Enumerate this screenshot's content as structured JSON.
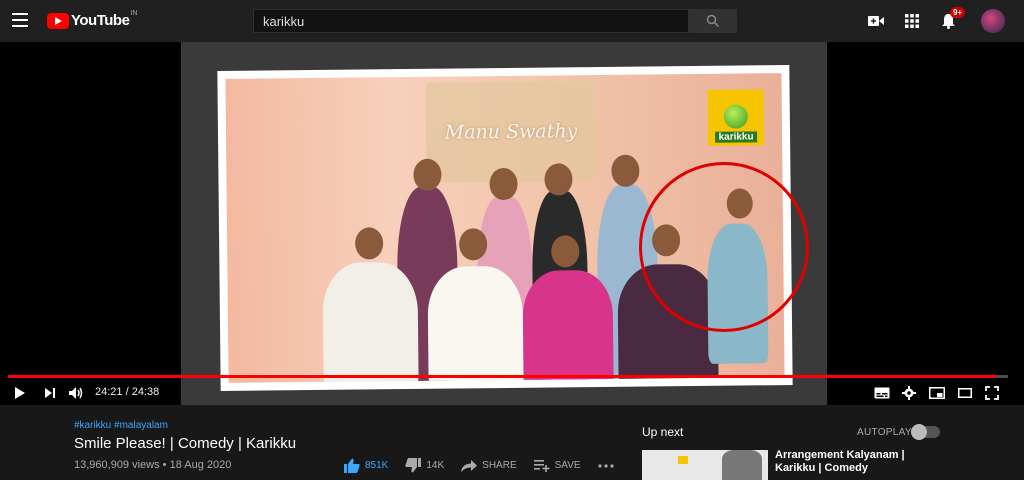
{
  "header": {
    "logo_text": "YouTube",
    "country_code": "IN",
    "search_value": "karikku",
    "notification_count": "9+"
  },
  "player": {
    "video_logo_text": "karikku",
    "stage_text": "Manu Swathy",
    "current_time": "24:21",
    "duration": "24:38",
    "time_display": "24:21 / 24:38",
    "progress_fraction": 0.988
  },
  "video": {
    "tags": "#karikku #malayalam",
    "title": "Smile Please! | Comedy | Karikku",
    "views_date": "13,960,909 views • 18 Aug 2020",
    "likes": "851K",
    "dislikes": "14K",
    "share_label": "SHARE",
    "save_label": "SAVE"
  },
  "sidebar": {
    "upnext_label": "Up next",
    "autoplay_label": "AUTOPLAY",
    "next_video_title_line1": "Arrangement Kalyanam |",
    "next_video_title_line2": "Karikku | Comedy"
  },
  "colors": {
    "brand_red": "#ff0000",
    "link_blue": "#3ea6ff",
    "background": "#181818"
  }
}
